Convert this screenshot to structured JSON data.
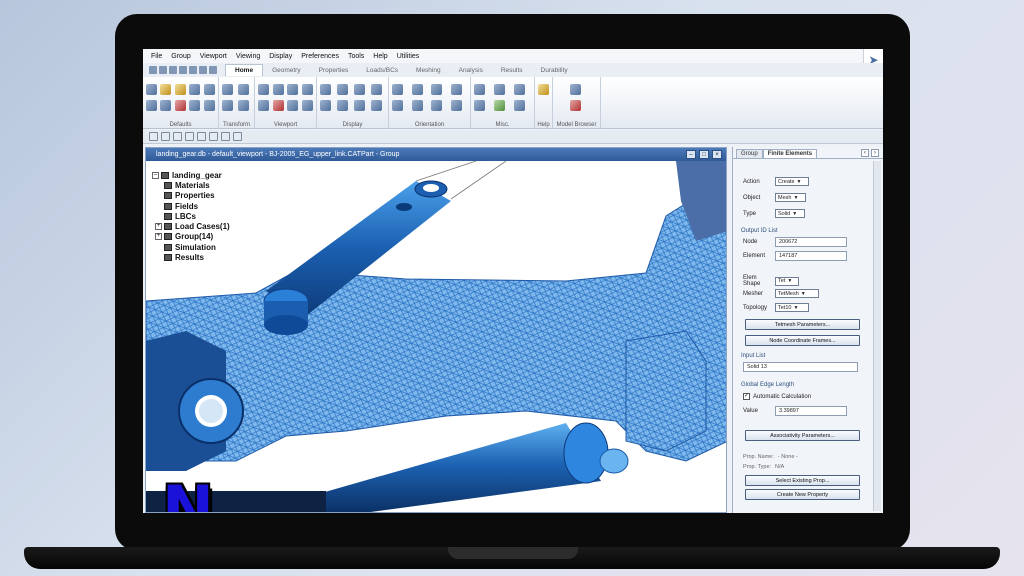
{
  "menu": [
    "File",
    "Group",
    "Viewport",
    "Viewing",
    "Display",
    "Preferences",
    "Tools",
    "Help",
    "Utilities"
  ],
  "ribbon_tabs": [
    "Home",
    "Geometry",
    "Properties",
    "Loads/BCs",
    "Meshing",
    "Analysis",
    "Results",
    "Durability"
  ],
  "active_tab": "Home",
  "ribbon_groups": [
    "Defaults",
    "Transform",
    "Viewport",
    "Display",
    "Orientation",
    "Misc.",
    "Help",
    "Model Browser"
  ],
  "viewport": {
    "title": "landing_gear.db - default_viewport - BJ-2005_EG_upper_link.CATPart - Group"
  },
  "tree": {
    "root": "landing_gear",
    "items": [
      "Materials",
      "Properties",
      "Fields",
      "LBCs",
      "Load Cases(1)",
      "Group(14)",
      "Simulation",
      "Results"
    ]
  },
  "panel": {
    "tabs": [
      "Group",
      "Finite Elements"
    ],
    "active_tab": "Finite Elements",
    "action_label": "Action",
    "action_value": "Create",
    "object_label": "Object",
    "object_value": "Mesh",
    "type_label": "Type",
    "type_value": "Solid",
    "output_id_label": "Output ID List",
    "node_label": "Node",
    "node_value": "200672",
    "element_label": "Element",
    "element_value": "147187",
    "elem_shape_label": "Elem Shape",
    "elem_shape_value": "Tet",
    "mesher_label": "Mesher",
    "mesher_value": "TetMesh",
    "topology_label": "Topology",
    "topology_value": "Tet10",
    "tetmesh_params_btn": "Tetmesh Parameters...",
    "node_coord_btn": "Node Coordinate Frames...",
    "input_list_label": "Input List",
    "input_list_value": "Solid 13",
    "edge_length_label": "Global Edge Length",
    "auto_calc_label": "Automatic Calculation",
    "value_label": "Value",
    "value_value": "3.39897",
    "assoc_params_btn": "Associativity Parameters...",
    "prop_name_label": "Prop. Name:",
    "prop_name_value": "- None -",
    "prop_type_label": "Prop. Type:",
    "prop_type_value": "N/A",
    "select_prop_btn": "Select Existing Prop...",
    "create_prop_btn": "Create New Property"
  },
  "logo_letter": "N"
}
